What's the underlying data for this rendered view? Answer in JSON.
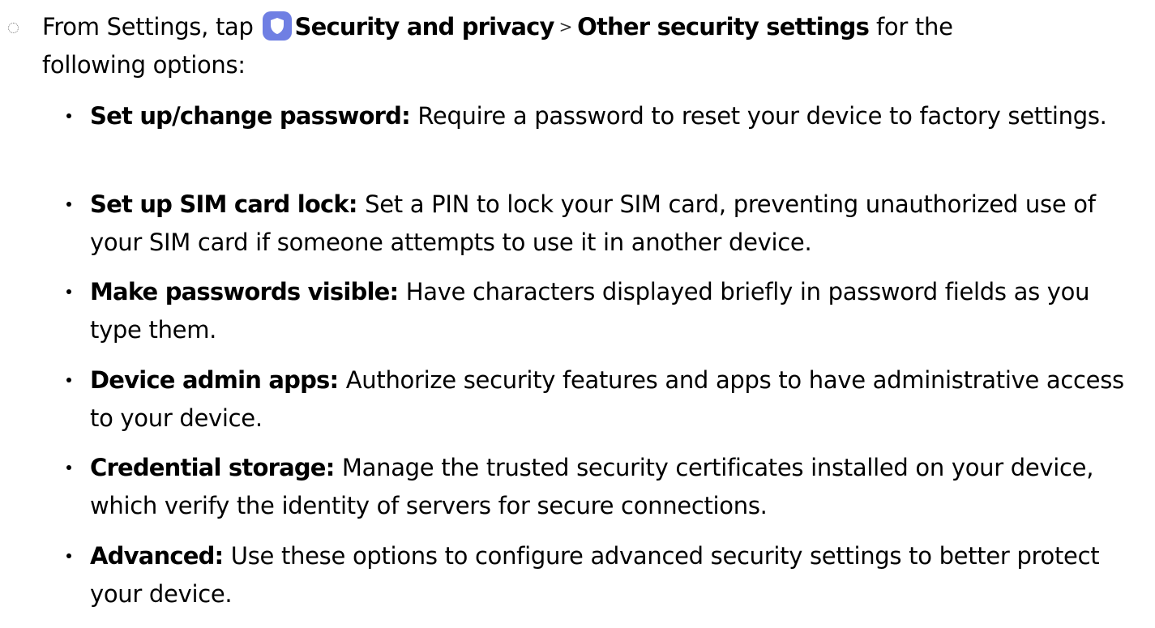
{
  "step": {
    "intro": "From Settings, tap",
    "icon": "shield-icon",
    "icon_color": "#6f7fe3",
    "menu_item": "Security and privacy",
    "separator": ">",
    "submenu_item": "Other security settings",
    "tail_line1": " for the",
    "tail_line2": "following options:"
  },
  "options": [
    {
      "term": "Set up/change password",
      "description": "Require a password to reset your device to factory settings."
    },
    {
      "term": "Set up SIM card lock",
      "description": "Set a PIN to lock your SIM card, preventing unauthorized use of your SIM card if someone attempts to use it in another device."
    },
    {
      "term": "Make passwords visible",
      "description": "Have characters displayed briefly in password fields as you type them."
    },
    {
      "term": "Device admin apps",
      "description": "Authorize security features and apps to have administrative access to your device."
    },
    {
      "term": "Credential storage",
      "description": "Manage the trusted security certificates installed on your device, which verify the identity of servers for secure connections."
    },
    {
      "term": "Advanced",
      "description": "Use these options to configure advanced security settings to better protect your device."
    }
  ]
}
